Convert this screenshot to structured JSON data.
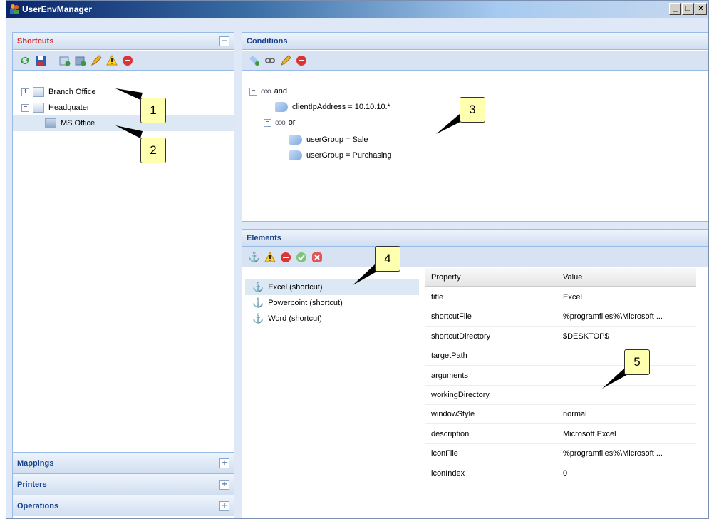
{
  "window": {
    "title": "UserEnvManager",
    "buttons": [
      "_",
      "□",
      "×"
    ]
  },
  "shortcuts": {
    "title": "Shortcuts",
    "tree": [
      {
        "label": "Branch Office",
        "expander": "+"
      },
      {
        "label": "Headquater",
        "expander": "−"
      },
      {
        "label": "MS Office"
      }
    ]
  },
  "accordion": {
    "mappings": "Mappings",
    "printers": "Printers",
    "operations": "Operations",
    "expand": "+"
  },
  "conditions": {
    "title": "Conditions",
    "tree": {
      "and": "and",
      "client": "clientIpAddress = 10.10.10.*",
      "or": "or",
      "sale": "userGroup = Sale",
      "purchasing": "userGroup = Purchasing",
      "link": "ooo"
    }
  },
  "elements": {
    "title": "Elements",
    "items": [
      "Excel (shortcut)",
      "Powerpoint (shortcut)",
      "Word (shortcut)"
    ]
  },
  "grid": {
    "headers": [
      "Property",
      "Value"
    ],
    "rows": [
      [
        "title",
        "Excel"
      ],
      [
        "shortcutFile",
        "%programfiles%\\Microsoft ..."
      ],
      [
        "shortcutDirectory",
        "$DESKTOP$"
      ],
      [
        "targetPath",
        ""
      ],
      [
        "arguments",
        ""
      ],
      [
        "workingDirectory",
        ""
      ],
      [
        "windowStyle",
        "normal"
      ],
      [
        "description",
        "Microsoft Excel"
      ],
      [
        "iconFile",
        "%programfiles%\\Microsoft ..."
      ],
      [
        "iconIndex",
        "0"
      ]
    ]
  },
  "callouts": [
    "1",
    "2",
    "3",
    "4",
    "5"
  ],
  "colors": {
    "panel_header": "#15428b",
    "shortcuts_header": "#d03030",
    "callout": "#ffffb0"
  }
}
